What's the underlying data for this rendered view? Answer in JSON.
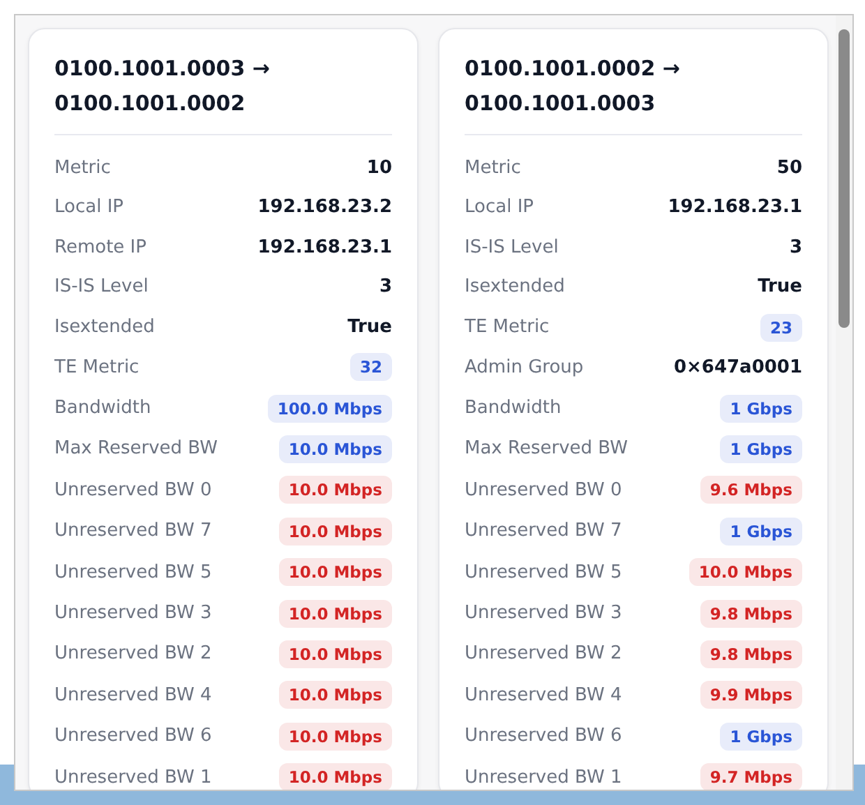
{
  "cards": [
    {
      "title": "0100.1001.0003 → 0100.1001.0002",
      "rows": [
        {
          "label": "Metric",
          "value": "10",
          "kind": "plain"
        },
        {
          "label": "Local IP",
          "value": "192.168.23.2",
          "kind": "plain"
        },
        {
          "label": "Remote IP",
          "value": "192.168.23.1",
          "kind": "plain"
        },
        {
          "label": "IS-IS Level",
          "value": "3",
          "kind": "plain"
        },
        {
          "label": "Isextended",
          "value": "True",
          "kind": "plain"
        },
        {
          "label": "TE Metric",
          "value": "32",
          "kind": "badge",
          "color": "#2a55d6"
        },
        {
          "label": "Bandwidth",
          "value": "100.0 Mbps",
          "kind": "badge",
          "color": "#2a55d6"
        },
        {
          "label": "Max Reserved BW",
          "value": "10.0 Mbps",
          "kind": "badge",
          "color": "#2a55d6"
        },
        {
          "label": "Unreserved BW 0",
          "value": "10.0 Mbps",
          "kind": "badge",
          "color": "#d32424"
        },
        {
          "label": "Unreserved BW 7",
          "value": "10.0 Mbps",
          "kind": "badge",
          "color": "#d32424"
        },
        {
          "label": "Unreserved BW 5",
          "value": "10.0 Mbps",
          "kind": "badge",
          "color": "#d32424"
        },
        {
          "label": "Unreserved BW 3",
          "value": "10.0 Mbps",
          "kind": "badge",
          "color": "#d32424"
        },
        {
          "label": "Unreserved BW 2",
          "value": "10.0 Mbps",
          "kind": "badge",
          "color": "#d32424"
        },
        {
          "label": "Unreserved BW 4",
          "value": "10.0 Mbps",
          "kind": "badge",
          "color": "#d32424"
        },
        {
          "label": "Unreserved BW 6",
          "value": "10.0 Mbps",
          "kind": "badge",
          "color": "#d32424"
        },
        {
          "label": "Unreserved BW 1",
          "value": "10.0 Mbps",
          "kind": "badge",
          "color": "#d32424"
        }
      ]
    },
    {
      "title": "0100.1001.0002 → 0100.1001.0003",
      "rows": [
        {
          "label": "Metric",
          "value": "50",
          "kind": "plain"
        },
        {
          "label": "Local IP",
          "value": "192.168.23.1",
          "kind": "plain"
        },
        {
          "label": "IS-IS Level",
          "value": "3",
          "kind": "plain"
        },
        {
          "label": "Isextended",
          "value": "True",
          "kind": "plain"
        },
        {
          "label": "TE Metric",
          "value": "23",
          "kind": "badge",
          "color": "#2a55d6"
        },
        {
          "label": "Admin Group",
          "value": "0×647a0001",
          "kind": "plain"
        },
        {
          "label": "Bandwidth",
          "value": "1 Gbps",
          "kind": "badge",
          "color": "#2a55d6"
        },
        {
          "label": "Max Reserved BW",
          "value": "1 Gbps",
          "kind": "badge",
          "color": "#2a55d6"
        },
        {
          "label": "Unreserved BW 0",
          "value": "9.6 Mbps",
          "kind": "badge",
          "color": "#d32424"
        },
        {
          "label": "Unreserved BW 7",
          "value": "1 Gbps",
          "kind": "badge",
          "color": "#2a55d6"
        },
        {
          "label": "Unreserved BW 5",
          "value": "10.0 Mbps",
          "kind": "badge",
          "color": "#d32424"
        },
        {
          "label": "Unreserved BW 3",
          "value": "9.8 Mbps",
          "kind": "badge",
          "color": "#d32424"
        },
        {
          "label": "Unreserved BW 2",
          "value": "9.8 Mbps",
          "kind": "badge",
          "color": "#d32424"
        },
        {
          "label": "Unreserved BW 4",
          "value": "9.9 Mbps",
          "kind": "badge",
          "color": "#d32424"
        },
        {
          "label": "Unreserved BW 6",
          "value": "1 Gbps",
          "kind": "badge",
          "color": "#2a55d6"
        },
        {
          "label": "Unreserved BW 1",
          "value": "9.7 Mbps",
          "kind": "badge",
          "color": "#d32424"
        }
      ]
    }
  ]
}
